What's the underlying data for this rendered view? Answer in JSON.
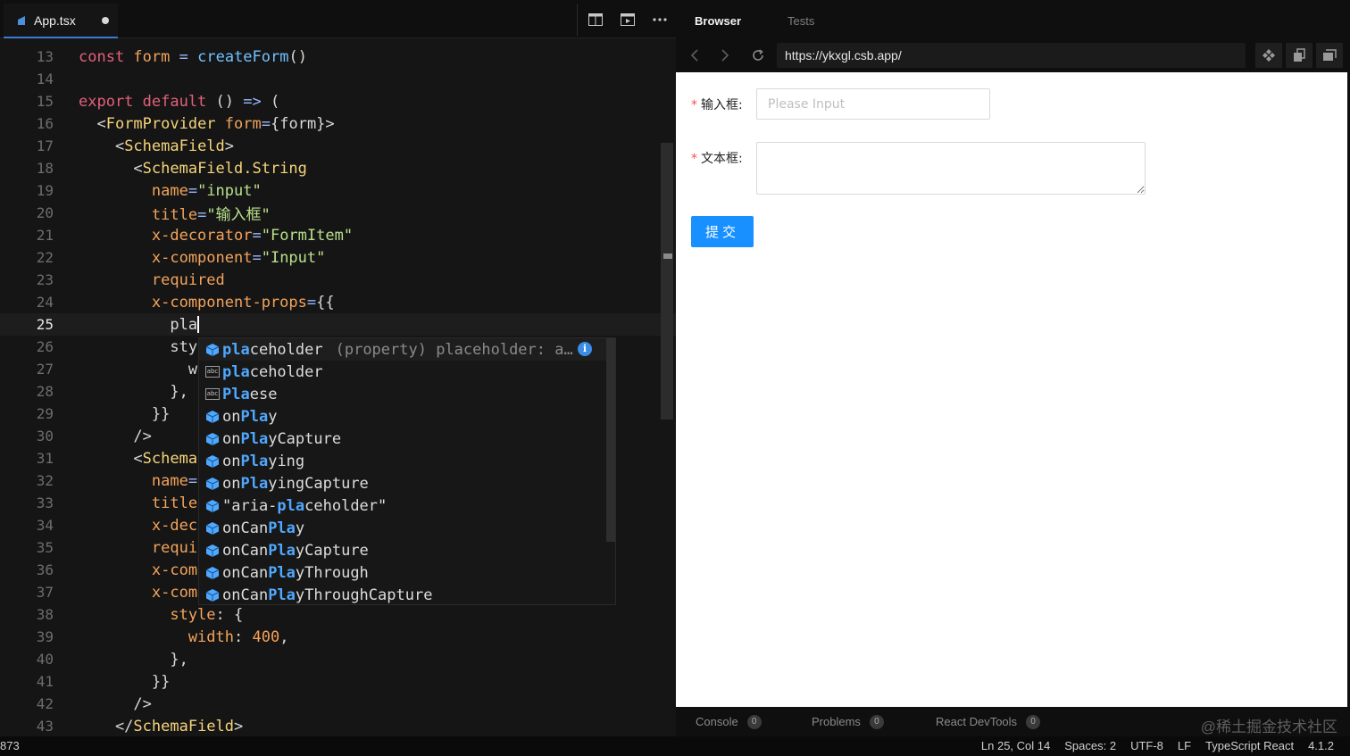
{
  "editor": {
    "tab": {
      "filename": "App.tsx"
    },
    "lines": [
      {
        "n": "13",
        "parts": [
          [
            "kw",
            "const "
          ],
          [
            "at",
            "form"
          ],
          [
            "pl",
            " "
          ],
          [
            "op",
            "="
          ],
          [
            "pl",
            " "
          ],
          [
            "fn",
            "createForm"
          ],
          [
            "pl",
            "()"
          ]
        ]
      },
      {
        "n": "14",
        "parts": []
      },
      {
        "n": "15",
        "parts": [
          [
            "kw",
            "export default"
          ],
          [
            "pl",
            " () "
          ],
          [
            "op",
            "=>"
          ],
          [
            "pl",
            " ("
          ]
        ]
      },
      {
        "n": "16",
        "parts": [
          [
            "pl",
            "  <"
          ],
          [
            "tg",
            "FormProvider"
          ],
          [
            "pl",
            " "
          ],
          [
            "at",
            "form"
          ],
          [
            "op",
            "="
          ],
          [
            "pl",
            "{form}>"
          ]
        ]
      },
      {
        "n": "17",
        "parts": [
          [
            "pl",
            "    <"
          ],
          [
            "tg",
            "SchemaField"
          ],
          [
            "pl",
            ">"
          ]
        ]
      },
      {
        "n": "18",
        "parts": [
          [
            "pl",
            "      <"
          ],
          [
            "tg",
            "SchemaField.String"
          ]
        ]
      },
      {
        "n": "19",
        "parts": [
          [
            "at",
            "        name"
          ],
          [
            "op",
            "="
          ],
          [
            "st",
            "\"input\""
          ]
        ]
      },
      {
        "n": "20",
        "parts": [
          [
            "at",
            "        title"
          ],
          [
            "op",
            "="
          ],
          [
            "st",
            "\"输入框\""
          ]
        ]
      },
      {
        "n": "21",
        "parts": [
          [
            "at",
            "        x-decorator"
          ],
          [
            "op",
            "="
          ],
          [
            "st",
            "\"FormItem\""
          ]
        ]
      },
      {
        "n": "22",
        "parts": [
          [
            "at",
            "        x-component"
          ],
          [
            "op",
            "="
          ],
          [
            "st",
            "\"Input\""
          ]
        ]
      },
      {
        "n": "23",
        "parts": [
          [
            "at",
            "        required"
          ]
        ]
      },
      {
        "n": "24",
        "parts": [
          [
            "at",
            "        x-component-props"
          ],
          [
            "op",
            "="
          ],
          [
            "pl",
            "{{"
          ]
        ]
      },
      {
        "n": "25",
        "parts": [
          [
            "pl",
            "          pla"
          ]
        ],
        "cursor": true
      },
      {
        "n": "26",
        "parts": [
          [
            "pl",
            "          sty"
          ]
        ]
      },
      {
        "n": "27",
        "parts": [
          [
            "pl",
            "            w"
          ]
        ]
      },
      {
        "n": "28",
        "parts": [
          [
            "pl",
            "          },"
          ]
        ]
      },
      {
        "n": "29",
        "parts": [
          [
            "pl",
            "        }}"
          ]
        ]
      },
      {
        "n": "30",
        "parts": [
          [
            "pl",
            "      />"
          ]
        ]
      },
      {
        "n": "31",
        "parts": [
          [
            "pl",
            "      <"
          ],
          [
            "tg",
            "Schema"
          ]
        ]
      },
      {
        "n": "32",
        "parts": [
          [
            "at",
            "        name"
          ],
          [
            "op",
            "="
          ]
        ]
      },
      {
        "n": "33",
        "parts": [
          [
            "at",
            "        title"
          ]
        ]
      },
      {
        "n": "34",
        "parts": [
          [
            "at",
            "        x-dec"
          ]
        ]
      },
      {
        "n": "35",
        "parts": [
          [
            "at",
            "        requi"
          ]
        ]
      },
      {
        "n": "36",
        "parts": [
          [
            "at",
            "        x-com"
          ]
        ]
      },
      {
        "n": "37",
        "parts": [
          [
            "at",
            "        x-com"
          ]
        ]
      },
      {
        "n": "38",
        "parts": [
          [
            "at",
            "          style"
          ],
          [
            "pl",
            ": {"
          ]
        ]
      },
      {
        "n": "39",
        "parts": [
          [
            "at",
            "            width"
          ],
          [
            "pl",
            ": "
          ],
          [
            "nm",
            "400"
          ],
          [
            "pl",
            ","
          ]
        ]
      },
      {
        "n": "40",
        "parts": [
          [
            "pl",
            "          },"
          ]
        ]
      },
      {
        "n": "41",
        "parts": [
          [
            "pl",
            "        }}"
          ]
        ]
      },
      {
        "n": "42",
        "parts": [
          [
            "pl",
            "      />"
          ]
        ]
      },
      {
        "n": "43",
        "parts": [
          [
            "pl",
            "    </"
          ],
          [
            "tg",
            "SchemaField"
          ],
          [
            "pl",
            ">"
          ]
        ]
      }
    ],
    "suggest": {
      "items": [
        {
          "icon": "cube",
          "match": "pla",
          "rest": "ceholder",
          "pre": "",
          "detail": "(property) placeholder: a…",
          "selected": true
        },
        {
          "icon": "abc",
          "match": "pla",
          "rest": "ceholder",
          "pre": ""
        },
        {
          "icon": "abc",
          "match": "Pl",
          "rest": "e",
          "pre": "",
          "mid": "a",
          "tail": "se"
        },
        {
          "icon": "cube",
          "pre": "on",
          "match": "Pla",
          "rest": "y"
        },
        {
          "icon": "cube",
          "pre": "on",
          "match": "Pla",
          "rest": "yCapture"
        },
        {
          "icon": "cube",
          "pre": "on",
          "match": "Pla",
          "rest": "ying"
        },
        {
          "icon": "cube",
          "pre": "on",
          "match": "Pla",
          "rest": "yingCapture"
        },
        {
          "icon": "cube",
          "pre": "\"aria-",
          "match": "pla",
          "rest": "ceholder\""
        },
        {
          "icon": "cube",
          "pre": "onCan",
          "match": "Pla",
          "rest": "y"
        },
        {
          "icon": "cube",
          "pre": "onCan",
          "match": "Pla",
          "rest": "yCapture"
        },
        {
          "icon": "cube",
          "pre": "onCan",
          "match": "Pla",
          "rest": "yThrough"
        },
        {
          "icon": "cube",
          "pre": "onCan",
          "match": "Pla",
          "rest": "yThroughCapture"
        }
      ]
    }
  },
  "browser": {
    "tabs": [
      "Browser",
      "Tests"
    ],
    "url": "https://ykxgl.csb.app/",
    "form": {
      "input_label": "输入框:",
      "input_placeholder": "Please Input",
      "textarea_label": "文本框:",
      "required_mark": "*",
      "submit_label": "提交"
    },
    "devtools": [
      {
        "label": "Console",
        "count": "0"
      },
      {
        "label": "Problems",
        "count": "0"
      },
      {
        "label": "React DevTools",
        "count": "0"
      }
    ],
    "watermark": "@稀土掘金技术社区"
  },
  "statusbar": {
    "left": "873",
    "items": [
      "Ln 25, Col 14",
      "Spaces: 2",
      "UTF-8",
      "LF",
      "TypeScript React",
      "4.1.2"
    ]
  },
  "colors": {
    "accent": "#1890ff",
    "required": "#ff4d4f",
    "match": "#4fa8ff"
  }
}
